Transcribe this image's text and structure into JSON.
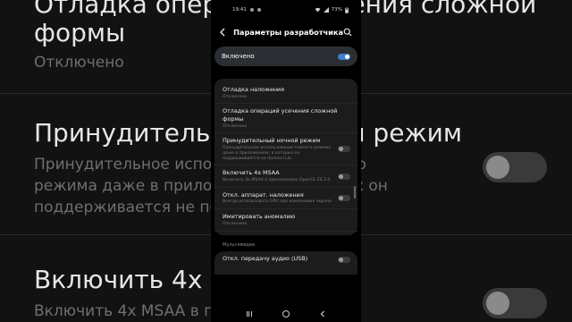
{
  "background": {
    "rows": [
      {
        "title": "Отладка операций усечения сложной",
        "title2": "формы",
        "sub": "Отключено"
      },
      {
        "title": "Принудительный ночной режим",
        "sub1": "Принудительное использование темного",
        "sub2": "режима даже в приложениях, в которых он",
        "sub3": "поддерживается не полностью."
      },
      {
        "title": "Включить 4x MSAA",
        "sub1": "Включить 4x MSAA в приложениях"
      }
    ]
  },
  "status_bar": {
    "time": "19:41",
    "battery": "73%"
  },
  "app_bar": {
    "title": "Параметры разработчика"
  },
  "master_switch": {
    "label": "Включено",
    "on": true
  },
  "items": [
    {
      "title": "Отладка наложения",
      "sub": "Отключено",
      "has_toggle": false
    },
    {
      "title": "Отладка операций усечения сложной формы",
      "sub": "Отключено",
      "has_toggle": false
    },
    {
      "title": "Принудительный ночной режим",
      "sub": "Принудительное использование темного режима даже в приложениях, в которых он поддерживается не полностью.",
      "has_toggle": true,
      "on": false
    },
    {
      "title": "Включить 4x MSAA",
      "sub": "Включить 4x MSAA в приложениях OpenGL ES 2.0",
      "has_toggle": true,
      "on": false
    },
    {
      "title": "Откл. аппарат. наложения",
      "sub": "Всегда использовать GPU при компоновке экрана",
      "has_toggle": true,
      "on": false
    },
    {
      "title": "Имитировать аномалию",
      "sub": "Отключено",
      "has_toggle": false
    }
  ],
  "section": {
    "label": "Мультимедиа"
  },
  "media_item": {
    "title": "Откл. передачу аудио (USB)",
    "on": false
  },
  "icons": {
    "back": "back-arrow-icon",
    "search": "search-icon",
    "recents": "recents-icon",
    "home": "home-icon",
    "nav_back": "nav-back-icon"
  },
  "colors": {
    "accent": "#3d7fcf",
    "card": "#1c1c1c",
    "master_bg": "#2b2f33"
  }
}
